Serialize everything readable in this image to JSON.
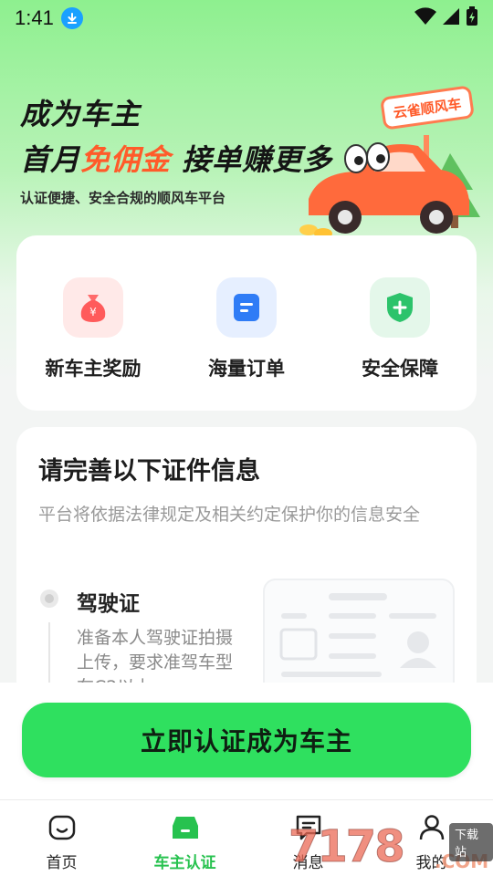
{
  "status_bar": {
    "time": "1:41"
  },
  "hero": {
    "line1": "成为车主",
    "line2_prefix": "首月",
    "line2_accent": "免佣金",
    "line2_suffix": " 接单赚更多",
    "subtitle": "认证便捷、安全合规的顺风车平台",
    "sign_text": "云雀顺风车",
    "coin_symbol": "¥"
  },
  "features": [
    {
      "label": "新车主奖励",
      "icon": "money-bag-icon",
      "color": "#ff5b5b"
    },
    {
      "label": "海量订单",
      "icon": "document-icon",
      "color": "#2f7cf6"
    },
    {
      "label": "安全保障",
      "icon": "shield-icon",
      "color": "#2cc36b"
    }
  ],
  "documents": {
    "title": "请完善以下证件信息",
    "description": "平台将依据法律规定及相关约定保护你的信息安全",
    "step": {
      "title": "驾驶证",
      "description": "准备本人驾驶证拍摄上传，要求准驾车型在C2以上"
    }
  },
  "cta": {
    "label": "立即认证成为车主",
    "color": "#2fe05f"
  },
  "tabs": [
    {
      "label": "首页",
      "icon": "home-icon",
      "active": false
    },
    {
      "label": "车主认证",
      "icon": "car-icon",
      "active": true
    },
    {
      "label": "消息",
      "icon": "message-icon",
      "active": false
    },
    {
      "label": "我的",
      "icon": "profile-icon",
      "active": false
    }
  ],
  "watermark": {
    "number": "7178",
    "suffix": ".COM",
    "tag": "下载站"
  },
  "colors": {
    "accent": "#27c24f",
    "hero_accent": "#ff5b2a"
  }
}
